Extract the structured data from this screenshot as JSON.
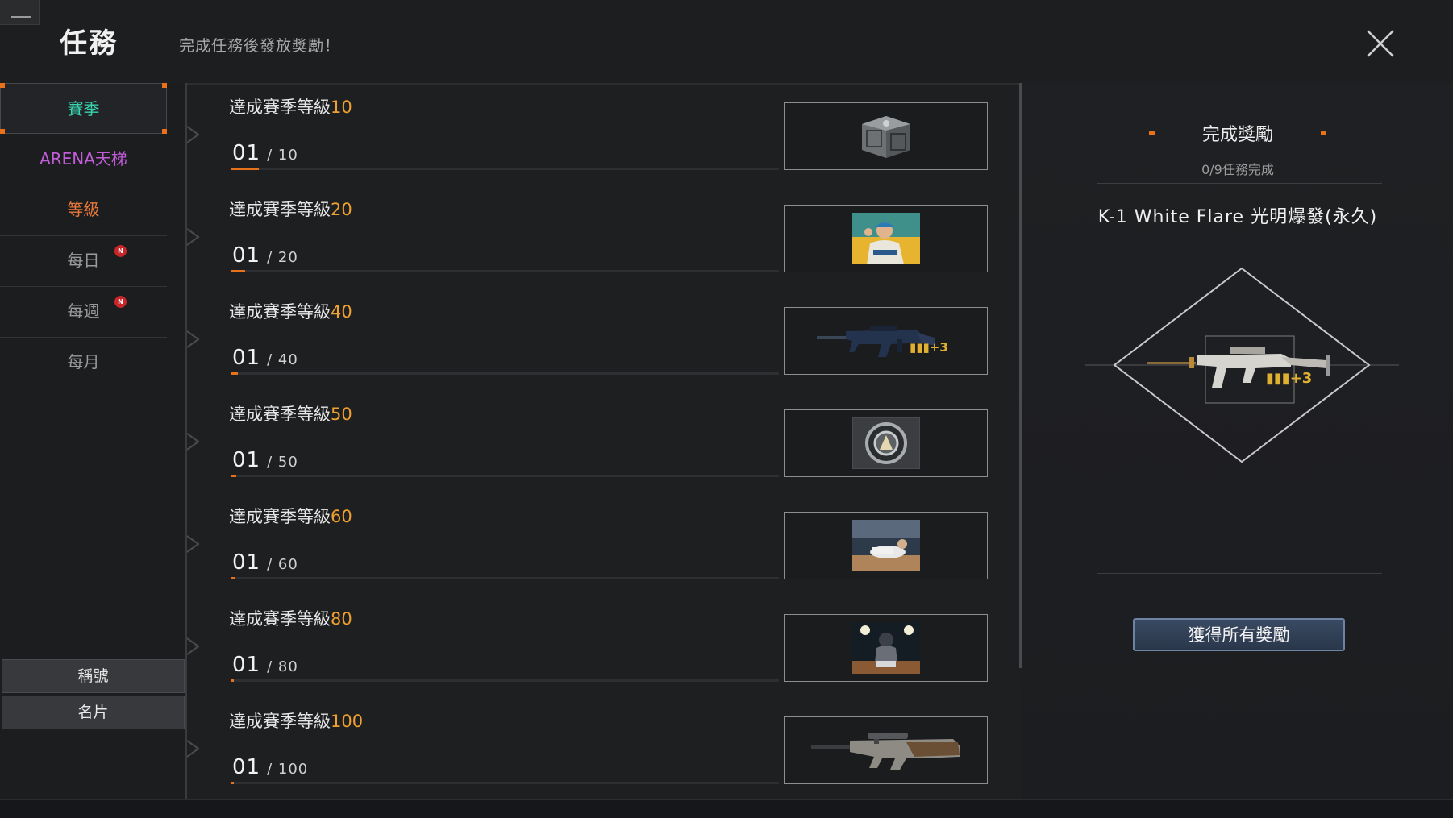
{
  "header": {
    "title": "任務",
    "subtitle": "完成任務後發放獎勵！"
  },
  "sidebar": {
    "tabs": [
      {
        "label": "賽季",
        "color": "#38d6b0",
        "active": true
      },
      {
        "label": "ARENA天梯",
        "color": "#c25cd8"
      },
      {
        "label": "等級",
        "color": "#e8783a"
      },
      {
        "label": "每日",
        "color": "#9a9a9a",
        "badge": "N"
      },
      {
        "label": "每週",
        "color": "#9a9a9a",
        "badge": "N"
      },
      {
        "label": "每月",
        "color": "#9a9a9a"
      }
    ],
    "bottom_buttons": [
      {
        "label": "稱號"
      },
      {
        "label": "名片"
      }
    ]
  },
  "missions": [
    {
      "title": "達成賽季等級",
      "level": "10",
      "current": "01",
      "total": "/ 10",
      "progress": 0.1,
      "reward_icon": "crate-icon"
    },
    {
      "title": "達成賽季等級",
      "level": "20",
      "current": "01",
      "total": "/ 20",
      "progress": 0.05,
      "reward_icon": "rookie-card-icon"
    },
    {
      "title": "達成賽季等級",
      "level": "40",
      "current": "01",
      "total": "/ 40",
      "progress": 0.025,
      "reward_icon": "rifle-icon",
      "reward_badge": "+3"
    },
    {
      "title": "達成賽季等級",
      "level": "50",
      "current": "01",
      "total": "/ 50",
      "progress": 0.02,
      "reward_icon": "emblem-icon"
    },
    {
      "title": "達成賽季等級",
      "level": "60",
      "current": "01",
      "total": "/ 60",
      "progress": 0.017,
      "reward_icon": "baseball-slide-card-icon"
    },
    {
      "title": "達成賽季等級",
      "level": "80",
      "current": "01",
      "total": "/ 80",
      "progress": 0.0125,
      "reward_icon": "catcher-card-icon"
    },
    {
      "title": "達成賽季等級",
      "level": "100",
      "current": "01",
      "total": "/ 100",
      "progress": 0.01,
      "reward_icon": "bullpup-rifle-icon"
    }
  ],
  "reward_panel": {
    "title": "完成獎勵",
    "progress_text": "0/9任務完成",
    "item_name": "K-1 White Flare 光明爆發(永久)",
    "item_badge": "+3",
    "claim_button": "獲得所有獎勵"
  },
  "colors": {
    "accent": "#e8721a",
    "level_number": "#f0a030",
    "ammo": "#e0b030"
  }
}
